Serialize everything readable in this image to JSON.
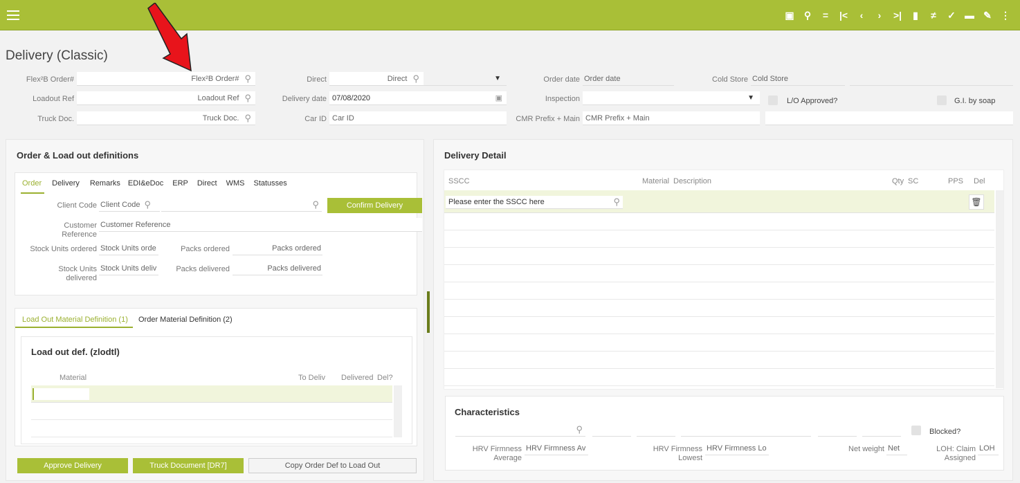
{
  "app": {
    "title": "Delivery (Classic)"
  },
  "header_fields": {
    "flex_order_label": "Flex²B Order#",
    "flex_order_placeholder": "Flex²B Order#",
    "loadout_ref_label": "Loadout Ref",
    "loadout_ref_placeholder": "Loadout Ref",
    "truck_doc_label": "Truck Doc.",
    "truck_doc_placeholder": "Truck Doc.",
    "direct_label": "Direct",
    "direct_placeholder": "Direct",
    "delivery_date_label": "Delivery date",
    "delivery_date_value": "07/08/2020",
    "car_id_label": "Car ID",
    "car_id_placeholder": "Car ID",
    "order_date_label": "Order date",
    "order_date_placeholder": "Order date",
    "cold_store_label": "Cold Store",
    "cold_store_placeholder": "Cold Store",
    "inspection_label": "Inspection",
    "lo_approved_label": "L/O Approved?",
    "gi_by_soap_label": "G.I. by soap",
    "cmr_label": "CMR Prefix + Main",
    "cmr_placeholder": "CMR Prefix + Main"
  },
  "order_panel": {
    "title": "Order & Load out definitions",
    "tabs": [
      "Order",
      "Delivery",
      "Remarks",
      "EDI&eDoc",
      "ERP",
      "Direct",
      "WMS",
      "Statusses"
    ],
    "client_code_label": "Client Code",
    "client_code_placeholder": "Client Code",
    "confirm_button": "Confirm Delivery",
    "customer_ref_label_1": "Customer",
    "customer_ref_label_2": "Reference",
    "customer_ref_placeholder": "Customer Reference",
    "stock_units_ordered_label": "Stock Units ordered",
    "stock_units_ordered_placeholder": "Stock Units orde",
    "packs_ordered_label": "Packs ordered",
    "packs_ordered_placeholder": "Packs ordered",
    "stock_units_delivered_label_1": "Stock Units",
    "stock_units_delivered_label_2": "delivered",
    "stock_units_delivered_placeholder": "Stock Units deliv",
    "packs_delivered_label": "Packs delivered",
    "packs_delivered_placeholder": "Packs delivered"
  },
  "material_panel": {
    "tabs": [
      "Load Out Material Definition (1)",
      "Order Material Definition (2)"
    ],
    "subtitle": "Load out def. (zlodtl)",
    "columns": [
      "Material",
      "To Deliv",
      "Delivered",
      "Del?"
    ]
  },
  "bottom_buttons": {
    "approve": "Approve Delivery",
    "truck_doc": "Truck Document [DR7]",
    "copy_order": "Copy Order Def to Load Out"
  },
  "delivery_detail": {
    "title": "Delivery Detail",
    "columns": [
      "SSCC",
      "Material",
      "Description",
      "Qty",
      "SC",
      "PPS",
      "Del"
    ],
    "sscc_placeholder": "Please enter the SSCC here"
  },
  "characteristics": {
    "title": "Characteristics",
    "blocked_label": "Blocked?",
    "hrv_avg_label_1": "HRV Firmness",
    "hrv_avg_label_2": "Average",
    "hrv_avg_placeholder": "HRV Firmness Av",
    "hrv_low_label_1": "HRV Firmness",
    "hrv_low_label_2": "Lowest",
    "hrv_low_placeholder": "HRV Firmness Lo",
    "net_weight_label": "Net weight",
    "net_weight_placeholder": "Net",
    "loh_label_1": "LOH: Claim",
    "loh_label_2": "Assigned",
    "loh_placeholder": "LOH"
  },
  "colors": {
    "accent": "#a9bf37",
    "annotation_arrow": "#e8141b"
  }
}
